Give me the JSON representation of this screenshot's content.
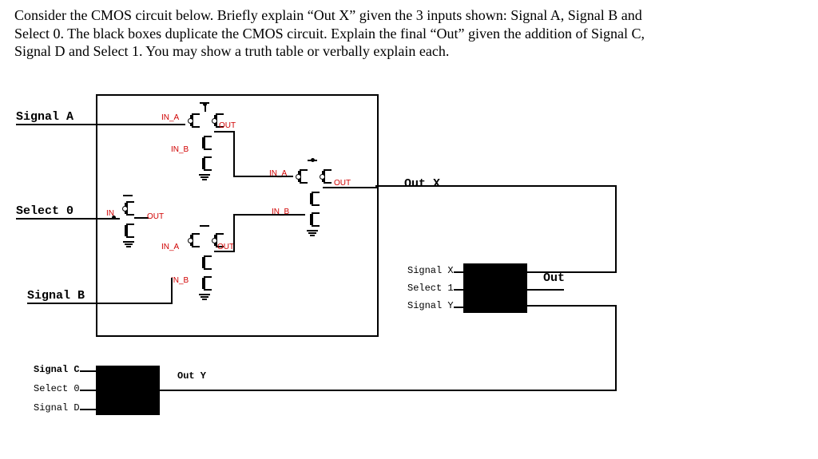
{
  "question": {
    "line1": "Consider the CMOS circuit below. Briefly explain “Out X” given the 3 inputs shown: Signal A, Signal B and",
    "line2": "Select 0. The black boxes duplicate the CMOS circuit. Explain the final “Out” given the addition of Signal C,",
    "line3": "Signal D and Select 1.  You may show a truth table or verbally explain each."
  },
  "labels": {
    "signalA": "Signal A",
    "signalB": "Signal B",
    "signalC": "Signal C",
    "signalD": "Signal D",
    "select0": "Select 0",
    "select0b": "Select 0",
    "select1": "Select 1",
    "signalX": "Signal X",
    "signalY": "Signal Y",
    "outX": "Out X",
    "outY": "Out Y",
    "out": "Out",
    "in": "IN",
    "in_a": "IN_A",
    "in_b": "IN_B",
    "out_s": "OUT"
  }
}
